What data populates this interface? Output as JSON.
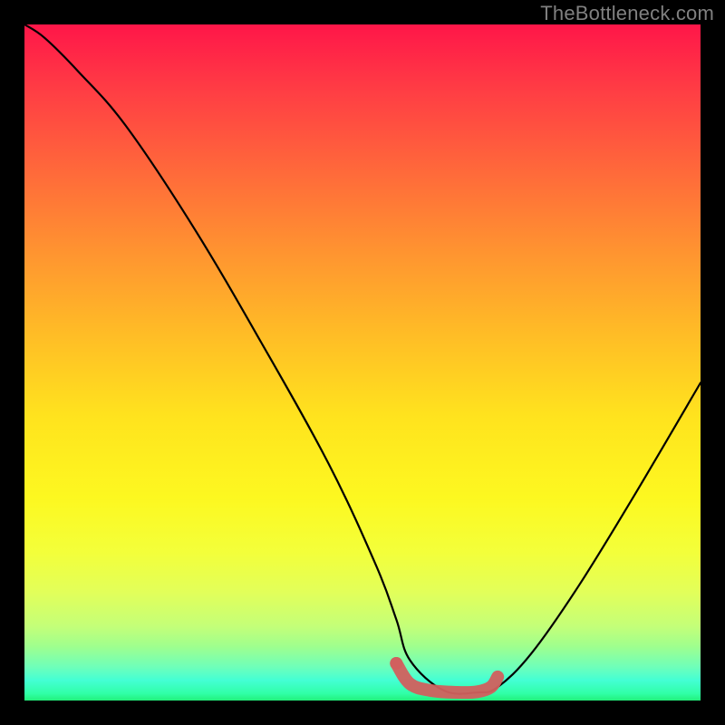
{
  "watermark": "TheBottleneck.com",
  "chart_data": {
    "type": "line",
    "title": "",
    "xlabel": "",
    "ylabel": "",
    "xlim": [
      0,
      100
    ],
    "ylim": [
      0,
      100
    ],
    "series": [
      {
        "name": "curve",
        "x": [
          0,
          3,
          8,
          15,
          25,
          35,
          45,
          52,
          55,
          57,
          62,
          67,
          70,
          75,
          82,
          90,
          100
        ],
        "y": [
          100,
          98,
          93,
          85,
          70,
          53,
          35,
          20,
          12,
          6,
          1.5,
          1.2,
          2,
          7,
          17,
          30,
          47
        ]
      },
      {
        "name": "highlight",
        "x": [
          55,
          57,
          60,
          64,
          67,
          69,
          70
        ],
        "y": [
          5.5,
          2.5,
          1.5,
          1.2,
          1.3,
          2,
          3.5
        ]
      }
    ],
    "colors": {
      "curve": "#000000",
      "highlight": "#d1605e"
    }
  }
}
